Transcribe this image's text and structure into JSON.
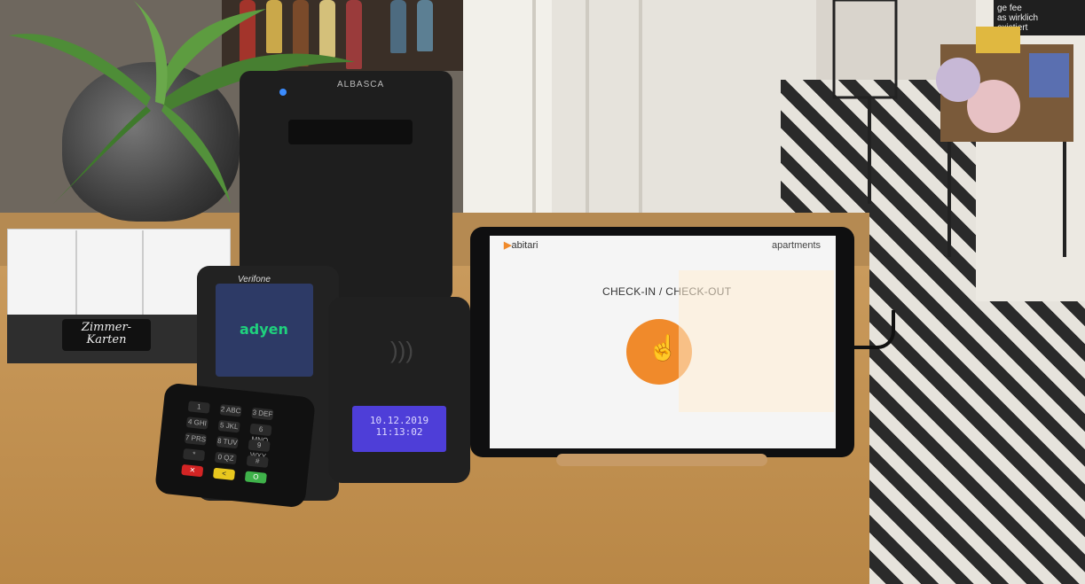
{
  "scene": {
    "chalkboard_text": "ge fee\nas wirklich\nexistiert",
    "card_tag_text": "Zimmer-\nKarten"
  },
  "printer": {
    "brand": "ALBASCA"
  },
  "payment_terminal": {
    "brand": "Verifone",
    "screen_logo": "adyen",
    "keys": [
      "1",
      "2 ABC",
      "3 DEF",
      "4 GHI",
      "5 JKL",
      "6 MNO",
      "7 PRS",
      "8 TUV",
      "9 WXY",
      "*",
      "0 QZ",
      "#",
      "✕",
      "<",
      "O"
    ]
  },
  "card_reader": {
    "date": "10.12.2019",
    "time": "11:13:02"
  },
  "tablet": {
    "app_logo": "abitari",
    "brand_right": "apartments",
    "title": "CHECK-IN / CHECK-OUT",
    "button_icon": "hand-pointer-icon",
    "accent_color": "#f08a2b"
  }
}
